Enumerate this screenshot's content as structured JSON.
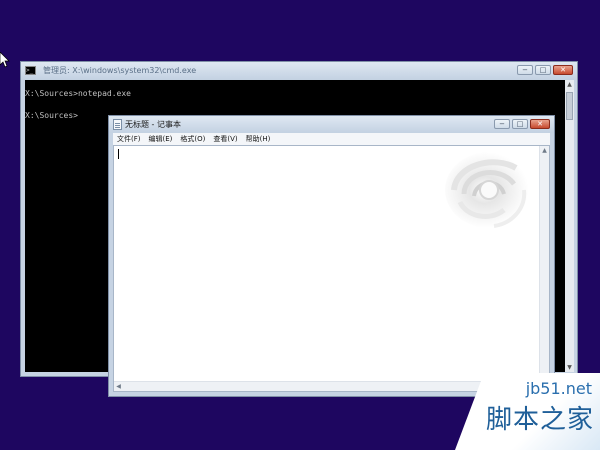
{
  "desktop": {
    "background": "#1e0660"
  },
  "cmd": {
    "title": "管理员: X:\\windows\\system32\\cmd.exe",
    "lines": [
      "X:\\Sources>notepad.exe",
      "X:\\Sources>"
    ],
    "buttons": {
      "minimize": "−",
      "maximize": "□",
      "close": "✕"
    }
  },
  "notepad": {
    "title": "无标题 - 记事本",
    "menu": [
      "文件(F)",
      "编辑(E)",
      "格式(O)",
      "查看(V)",
      "帮助(H)"
    ],
    "content": "",
    "buttons": {
      "minimize": "−",
      "maximize": "□",
      "close": "✕"
    }
  },
  "watermark": {
    "line1": "jb51.net",
    "line2": "脚本之家"
  }
}
